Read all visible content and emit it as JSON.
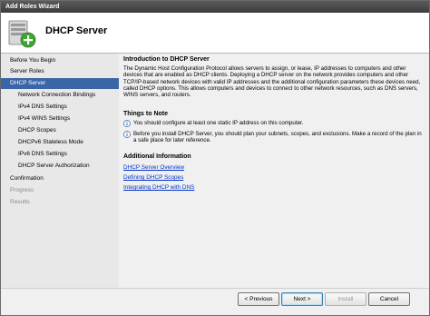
{
  "window": {
    "title": "Add Roles Wizard"
  },
  "header": {
    "title": "DHCP Server",
    "icon": "server-add-icon"
  },
  "sidebar": {
    "items": [
      {
        "label": "Before You Begin",
        "state": "normal",
        "level": 0
      },
      {
        "label": "Server Roles",
        "state": "normal",
        "level": 0
      },
      {
        "label": "DHCP Server",
        "state": "selected",
        "level": 0
      },
      {
        "label": "Network Connection Bindings",
        "state": "normal",
        "level": 1
      },
      {
        "label": "IPv4 DNS Settings",
        "state": "normal",
        "level": 1
      },
      {
        "label": "IPv4 WINS Settings",
        "state": "normal",
        "level": 1
      },
      {
        "label": "DHCP Scopes",
        "state": "normal",
        "level": 1
      },
      {
        "label": "DHCPv6 Stateless Mode",
        "state": "normal",
        "level": 1
      },
      {
        "label": "IPv6 DNS Settings",
        "state": "normal",
        "level": 1
      },
      {
        "label": "DHCP Server Authorization",
        "state": "normal",
        "level": 1
      },
      {
        "label": "Confirmation",
        "state": "normal",
        "level": 0
      },
      {
        "label": "Progress",
        "state": "disabled",
        "level": 0
      },
      {
        "label": "Results",
        "state": "disabled",
        "level": 0
      }
    ]
  },
  "content": {
    "intro_heading": "Introduction to DHCP Server",
    "intro_text": "The Dynamic Host Configuration Protocol allows servers to assign, or lease, IP addresses to computers and other devices that are enabled as DHCP clients. Deploying a DHCP server on the network provides computers and other TCP/IP-based network devices with valid IP addresses and the additional configuration parameters these devices need, called DHCP options. This allows computers and devices to connect to other network resources, such as DNS servers, WINS servers, and routers.",
    "notes_heading": "Things to Note",
    "notes": [
      "You should configure at least one static IP address on this computer.",
      "Before you install DHCP Server, you should plan your subnets, scopes, and exclusions. Make a record of the plan in a safe place for later reference."
    ],
    "info_heading": "Additional Information",
    "links": [
      "DHCP Server Overview",
      "Defining DHCP Scopes",
      "Integrating DHCP with DNS"
    ]
  },
  "buttons": {
    "previous": "< Previous",
    "next": "Next >",
    "install": "Install",
    "cancel": "Cancel"
  },
  "colors": {
    "selected_bg": "#3a66a8",
    "link": "#0033cc"
  }
}
